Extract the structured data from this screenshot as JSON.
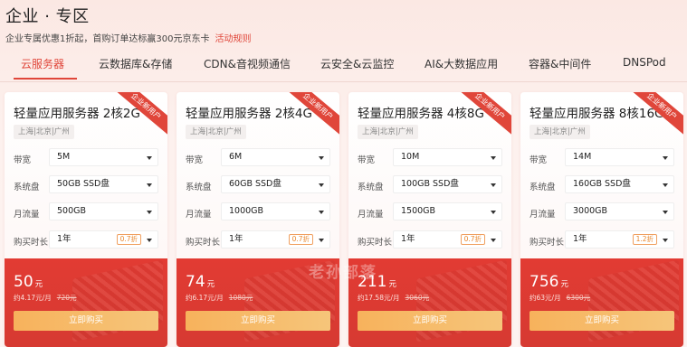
{
  "header": {
    "title": "企业 · 专区",
    "subtitle": "企业专属优惠1折起，首购订单达标赢300元京东卡",
    "rules_link": "活动规则"
  },
  "tabs": [
    {
      "label": "云服务器",
      "active": true
    },
    {
      "label": "云数据库&存储",
      "active": false
    },
    {
      "label": "CDN&音视频通信",
      "active": false
    },
    {
      "label": "云安全&云监控",
      "active": false
    },
    {
      "label": "AI&大数据应用",
      "active": false
    },
    {
      "label": "容器&中间件",
      "active": false
    },
    {
      "label": "DNSPod",
      "active": false
    }
  ],
  "labels": {
    "bandwidth": "带宽",
    "disk": "系统盘",
    "traffic": "月流量",
    "duration": "购买时长"
  },
  "cards": [
    {
      "title": "轻量应用服务器 2核2G",
      "ribbon": "企业新用户",
      "region": "上海|北京|广州",
      "bandwidth": "5M",
      "disk": "50GB SSD盘",
      "traffic": "500GB",
      "duration": "1年",
      "discount": "0.7折",
      "price": "50",
      "price_unit": "元",
      "monthly": "约4.17元/月",
      "original": "720元",
      "buy": "立即购买"
    },
    {
      "title": "轻量应用服务器 2核4G",
      "ribbon": "企业新用户",
      "region": "上海|北京|广州",
      "bandwidth": "6M",
      "disk": "60GB SSD盘",
      "traffic": "1000GB",
      "duration": "1年",
      "discount": "0.7折",
      "price": "74",
      "price_unit": "元",
      "monthly": "约6.17元/月",
      "original": "1080元",
      "buy": "立即购买"
    },
    {
      "title": "轻量应用服务器 4核8G",
      "ribbon": "企业新用户",
      "region": "上海|北京|广州",
      "bandwidth": "10M",
      "disk": "100GB SSD盘",
      "traffic": "1500GB",
      "duration": "1年",
      "discount": "0.7折",
      "price": "211",
      "price_unit": "元",
      "monthly": "约17.58元/月",
      "original": "3060元",
      "buy": "立即购买"
    },
    {
      "title": "轻量应用服务器 8核16G",
      "ribbon": "企业新用户",
      "region": "上海|北京|广州",
      "bandwidth": "14M",
      "disk": "160GB SSD盘",
      "traffic": "3000GB",
      "duration": "1年",
      "discount": "1.2折",
      "price": "756",
      "price_unit": "元",
      "monthly": "约63元/月",
      "original": "6300元",
      "buy": "立即购买"
    }
  ],
  "watermark": "老孙部落",
  "colors": {
    "accent": "#e0463a",
    "button": "#f7b25c",
    "discount": "#e8862c"
  }
}
